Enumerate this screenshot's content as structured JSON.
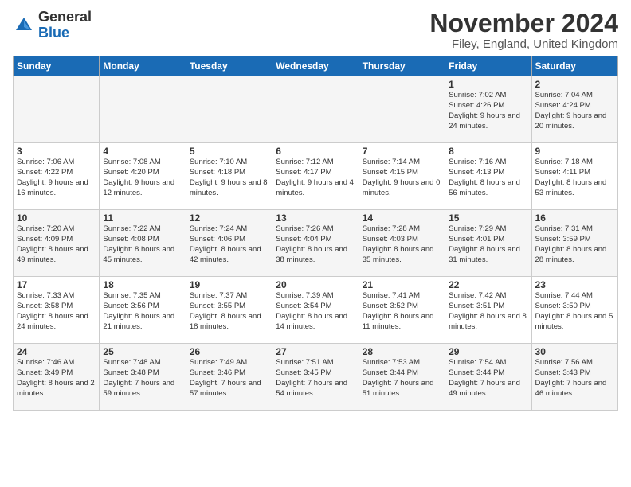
{
  "logo": {
    "general": "General",
    "blue": "Blue"
  },
  "title": "November 2024",
  "location": "Filey, England, United Kingdom",
  "days_header": [
    "Sunday",
    "Monday",
    "Tuesday",
    "Wednesday",
    "Thursday",
    "Friday",
    "Saturday"
  ],
  "weeks": [
    [
      {
        "day": "",
        "info": ""
      },
      {
        "day": "",
        "info": ""
      },
      {
        "day": "",
        "info": ""
      },
      {
        "day": "",
        "info": ""
      },
      {
        "day": "",
        "info": ""
      },
      {
        "day": "1",
        "info": "Sunrise: 7:02 AM\nSunset: 4:26 PM\nDaylight: 9 hours and 24 minutes."
      },
      {
        "day": "2",
        "info": "Sunrise: 7:04 AM\nSunset: 4:24 PM\nDaylight: 9 hours and 20 minutes."
      }
    ],
    [
      {
        "day": "3",
        "info": "Sunrise: 7:06 AM\nSunset: 4:22 PM\nDaylight: 9 hours and 16 minutes."
      },
      {
        "day": "4",
        "info": "Sunrise: 7:08 AM\nSunset: 4:20 PM\nDaylight: 9 hours and 12 minutes."
      },
      {
        "day": "5",
        "info": "Sunrise: 7:10 AM\nSunset: 4:18 PM\nDaylight: 9 hours and 8 minutes."
      },
      {
        "day": "6",
        "info": "Sunrise: 7:12 AM\nSunset: 4:17 PM\nDaylight: 9 hours and 4 minutes."
      },
      {
        "day": "7",
        "info": "Sunrise: 7:14 AM\nSunset: 4:15 PM\nDaylight: 9 hours and 0 minutes."
      },
      {
        "day": "8",
        "info": "Sunrise: 7:16 AM\nSunset: 4:13 PM\nDaylight: 8 hours and 56 minutes."
      },
      {
        "day": "9",
        "info": "Sunrise: 7:18 AM\nSunset: 4:11 PM\nDaylight: 8 hours and 53 minutes."
      }
    ],
    [
      {
        "day": "10",
        "info": "Sunrise: 7:20 AM\nSunset: 4:09 PM\nDaylight: 8 hours and 49 minutes."
      },
      {
        "day": "11",
        "info": "Sunrise: 7:22 AM\nSunset: 4:08 PM\nDaylight: 8 hours and 45 minutes."
      },
      {
        "day": "12",
        "info": "Sunrise: 7:24 AM\nSunset: 4:06 PM\nDaylight: 8 hours and 42 minutes."
      },
      {
        "day": "13",
        "info": "Sunrise: 7:26 AM\nSunset: 4:04 PM\nDaylight: 8 hours and 38 minutes."
      },
      {
        "day": "14",
        "info": "Sunrise: 7:28 AM\nSunset: 4:03 PM\nDaylight: 8 hours and 35 minutes."
      },
      {
        "day": "15",
        "info": "Sunrise: 7:29 AM\nSunset: 4:01 PM\nDaylight: 8 hours and 31 minutes."
      },
      {
        "day": "16",
        "info": "Sunrise: 7:31 AM\nSunset: 3:59 PM\nDaylight: 8 hours and 28 minutes."
      }
    ],
    [
      {
        "day": "17",
        "info": "Sunrise: 7:33 AM\nSunset: 3:58 PM\nDaylight: 8 hours and 24 minutes."
      },
      {
        "day": "18",
        "info": "Sunrise: 7:35 AM\nSunset: 3:56 PM\nDaylight: 8 hours and 21 minutes."
      },
      {
        "day": "19",
        "info": "Sunrise: 7:37 AM\nSunset: 3:55 PM\nDaylight: 8 hours and 18 minutes."
      },
      {
        "day": "20",
        "info": "Sunrise: 7:39 AM\nSunset: 3:54 PM\nDaylight: 8 hours and 14 minutes."
      },
      {
        "day": "21",
        "info": "Sunrise: 7:41 AM\nSunset: 3:52 PM\nDaylight: 8 hours and 11 minutes."
      },
      {
        "day": "22",
        "info": "Sunrise: 7:42 AM\nSunset: 3:51 PM\nDaylight: 8 hours and 8 minutes."
      },
      {
        "day": "23",
        "info": "Sunrise: 7:44 AM\nSunset: 3:50 PM\nDaylight: 8 hours and 5 minutes."
      }
    ],
    [
      {
        "day": "24",
        "info": "Sunrise: 7:46 AM\nSunset: 3:49 PM\nDaylight: 8 hours and 2 minutes."
      },
      {
        "day": "25",
        "info": "Sunrise: 7:48 AM\nSunset: 3:48 PM\nDaylight: 7 hours and 59 minutes."
      },
      {
        "day": "26",
        "info": "Sunrise: 7:49 AM\nSunset: 3:46 PM\nDaylight: 7 hours and 57 minutes."
      },
      {
        "day": "27",
        "info": "Sunrise: 7:51 AM\nSunset: 3:45 PM\nDaylight: 7 hours and 54 minutes."
      },
      {
        "day": "28",
        "info": "Sunrise: 7:53 AM\nSunset: 3:44 PM\nDaylight: 7 hours and 51 minutes."
      },
      {
        "day": "29",
        "info": "Sunrise: 7:54 AM\nSunset: 3:44 PM\nDaylight: 7 hours and 49 minutes."
      },
      {
        "day": "30",
        "info": "Sunrise: 7:56 AM\nSunset: 3:43 PM\nDaylight: 7 hours and 46 minutes."
      }
    ]
  ]
}
